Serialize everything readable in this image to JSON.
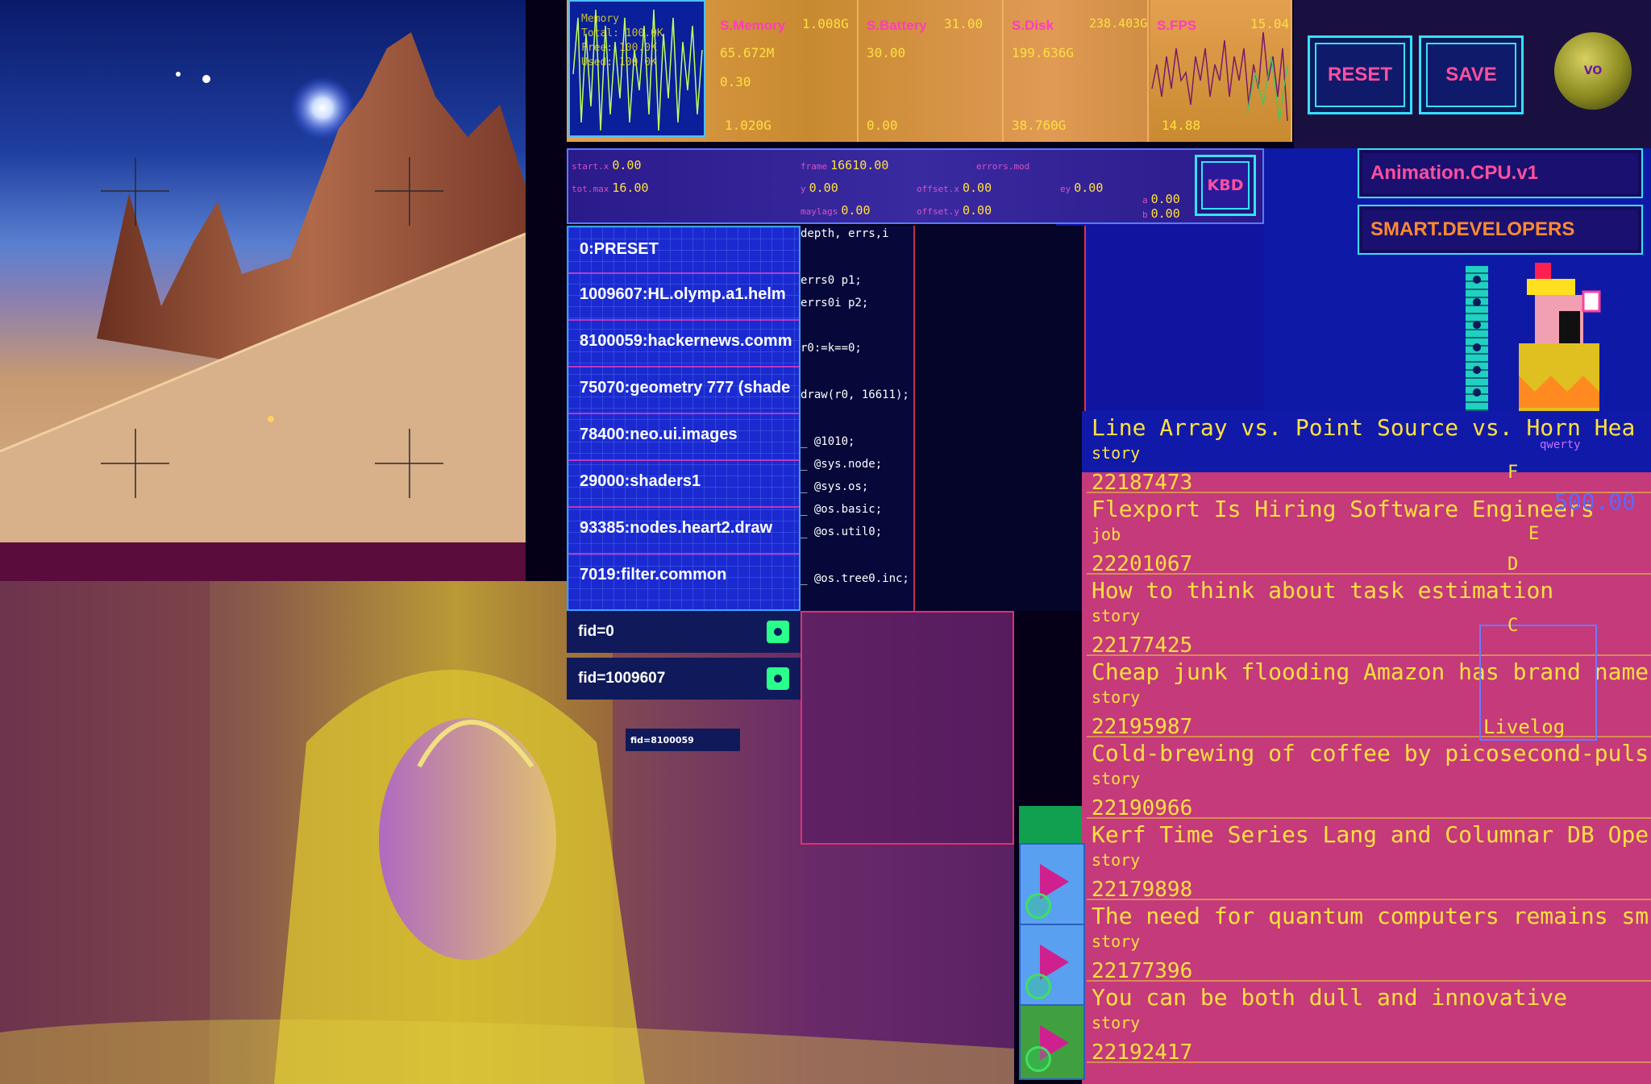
{
  "stats": {
    "memory": {
      "label": "Memory",
      "lines": [
        "Total: 100.0K",
        "Free: 100.0K",
        "Used: 100.0K"
      ]
    },
    "cells": [
      {
        "label": "S.Memory",
        "top_right": "1.008G",
        "v1": "65.672M",
        "v2": "0.30",
        "v3": "1.020G"
      },
      {
        "label": "S.Battery",
        "top_right": "31.00",
        "v1": "30.00",
        "v2": "",
        "v3": "0.00"
      },
      {
        "label": "S.Disk",
        "top_right": "238.403G",
        "v1": "199.636G",
        "v2": "",
        "v3": "38.760G"
      },
      {
        "label": "S.FPS",
        "top_right": "15.04",
        "v1": "",
        "v2": "",
        "v3": "14.88"
      }
    ]
  },
  "buttons": {
    "reset": "RESET",
    "save": "SAVE",
    "globe": "VO",
    "kbd": "KBD"
  },
  "tags": {
    "animation": "Animation.CPU.v1",
    "developers": "SMART.DEVELOPERS"
  },
  "controls": [
    {
      "key": "start.x",
      "value": "0.00"
    },
    {
      "key": "frame",
      "value": "16610.00"
    },
    {
      "key": "errors.mod",
      "value": ""
    },
    {
      "key": "tot.max",
      "value": "16.00"
    },
    {
      "key": "y",
      "value": "0.00"
    },
    {
      "key": "offset.x",
      "value": "0.00"
    },
    {
      "key": "ey",
      "value": "0.00"
    },
    {
      "key": "maylags",
      "value": "0.00"
    },
    {
      "key": "offset.y",
      "value": "0.00"
    },
    {
      "key": "a",
      "value": "0.00"
    },
    {
      "key": "b",
      "value": "0.00"
    }
  ],
  "presets": [
    "0:PRESET",
    "1009607:HL.olymp.a1.helm",
    "8100059:hackernews.comm",
    "75070:geometry 777 (shade",
    "78400:neo.ui.images",
    "29000:shaders1",
    "93385:nodes.heart2.draw",
    "7019:filter.common"
  ],
  "code_lines": [
    "depth, errs,i",
    "errs0 p1;",
    "errs0i p2;",
    "r0:=k==0;",
    "draw(r0, 16611);",
    "_ @1010;",
    "_ @sys.node;",
    "_ @sys.os;",
    "_ @os.basic;",
    "_ @os.util0;",
    "_ @os.tree0.inc;"
  ],
  "fids": [
    "fid=0",
    "fid=1009607"
  ],
  "fid_small": "fid=8100059",
  "stories": [
    {
      "title": "Line Array vs. Point Source vs. Horn Hea",
      "type": "story",
      "id": "22187473"
    },
    {
      "title": "Flexport Is Hiring Software Engineers",
      "type": "job",
      "id": "22201067"
    },
    {
      "title": "How to think about task estimation",
      "type": "story",
      "id": "22177425"
    },
    {
      "title": "Cheap junk flooding Amazon has brand name",
      "type": "story",
      "id": "22195987"
    },
    {
      "title": "Cold-brewing of coffee by picosecond-puls",
      "type": "story",
      "id": "22190966"
    },
    {
      "title": "Kerf Time Series Lang and Columnar DB Ope",
      "type": "story",
      "id": "22179898"
    },
    {
      "title": "The need for quantum computers remains sm",
      "type": "story",
      "id": "22177396"
    },
    {
      "title": "You can be both dull and innovative",
      "type": "story",
      "id": "22192417"
    }
  ],
  "livelog": {
    "label": "Livelog",
    "keys": [
      "F",
      "E",
      "D",
      "C"
    ],
    "qwerty": "qwerty",
    "value": "500.00"
  },
  "colors": {
    "accent_pink": "#ff3cbf",
    "accent_cyan": "#36e0ff",
    "accent_yellow": "#ffe040",
    "story_bg": "#c43a7a",
    "panel_blue": "#1a2ad0"
  },
  "icons": [
    "globe-icon",
    "play-icon",
    "status-dot-icon",
    "crosshair-icon"
  ]
}
